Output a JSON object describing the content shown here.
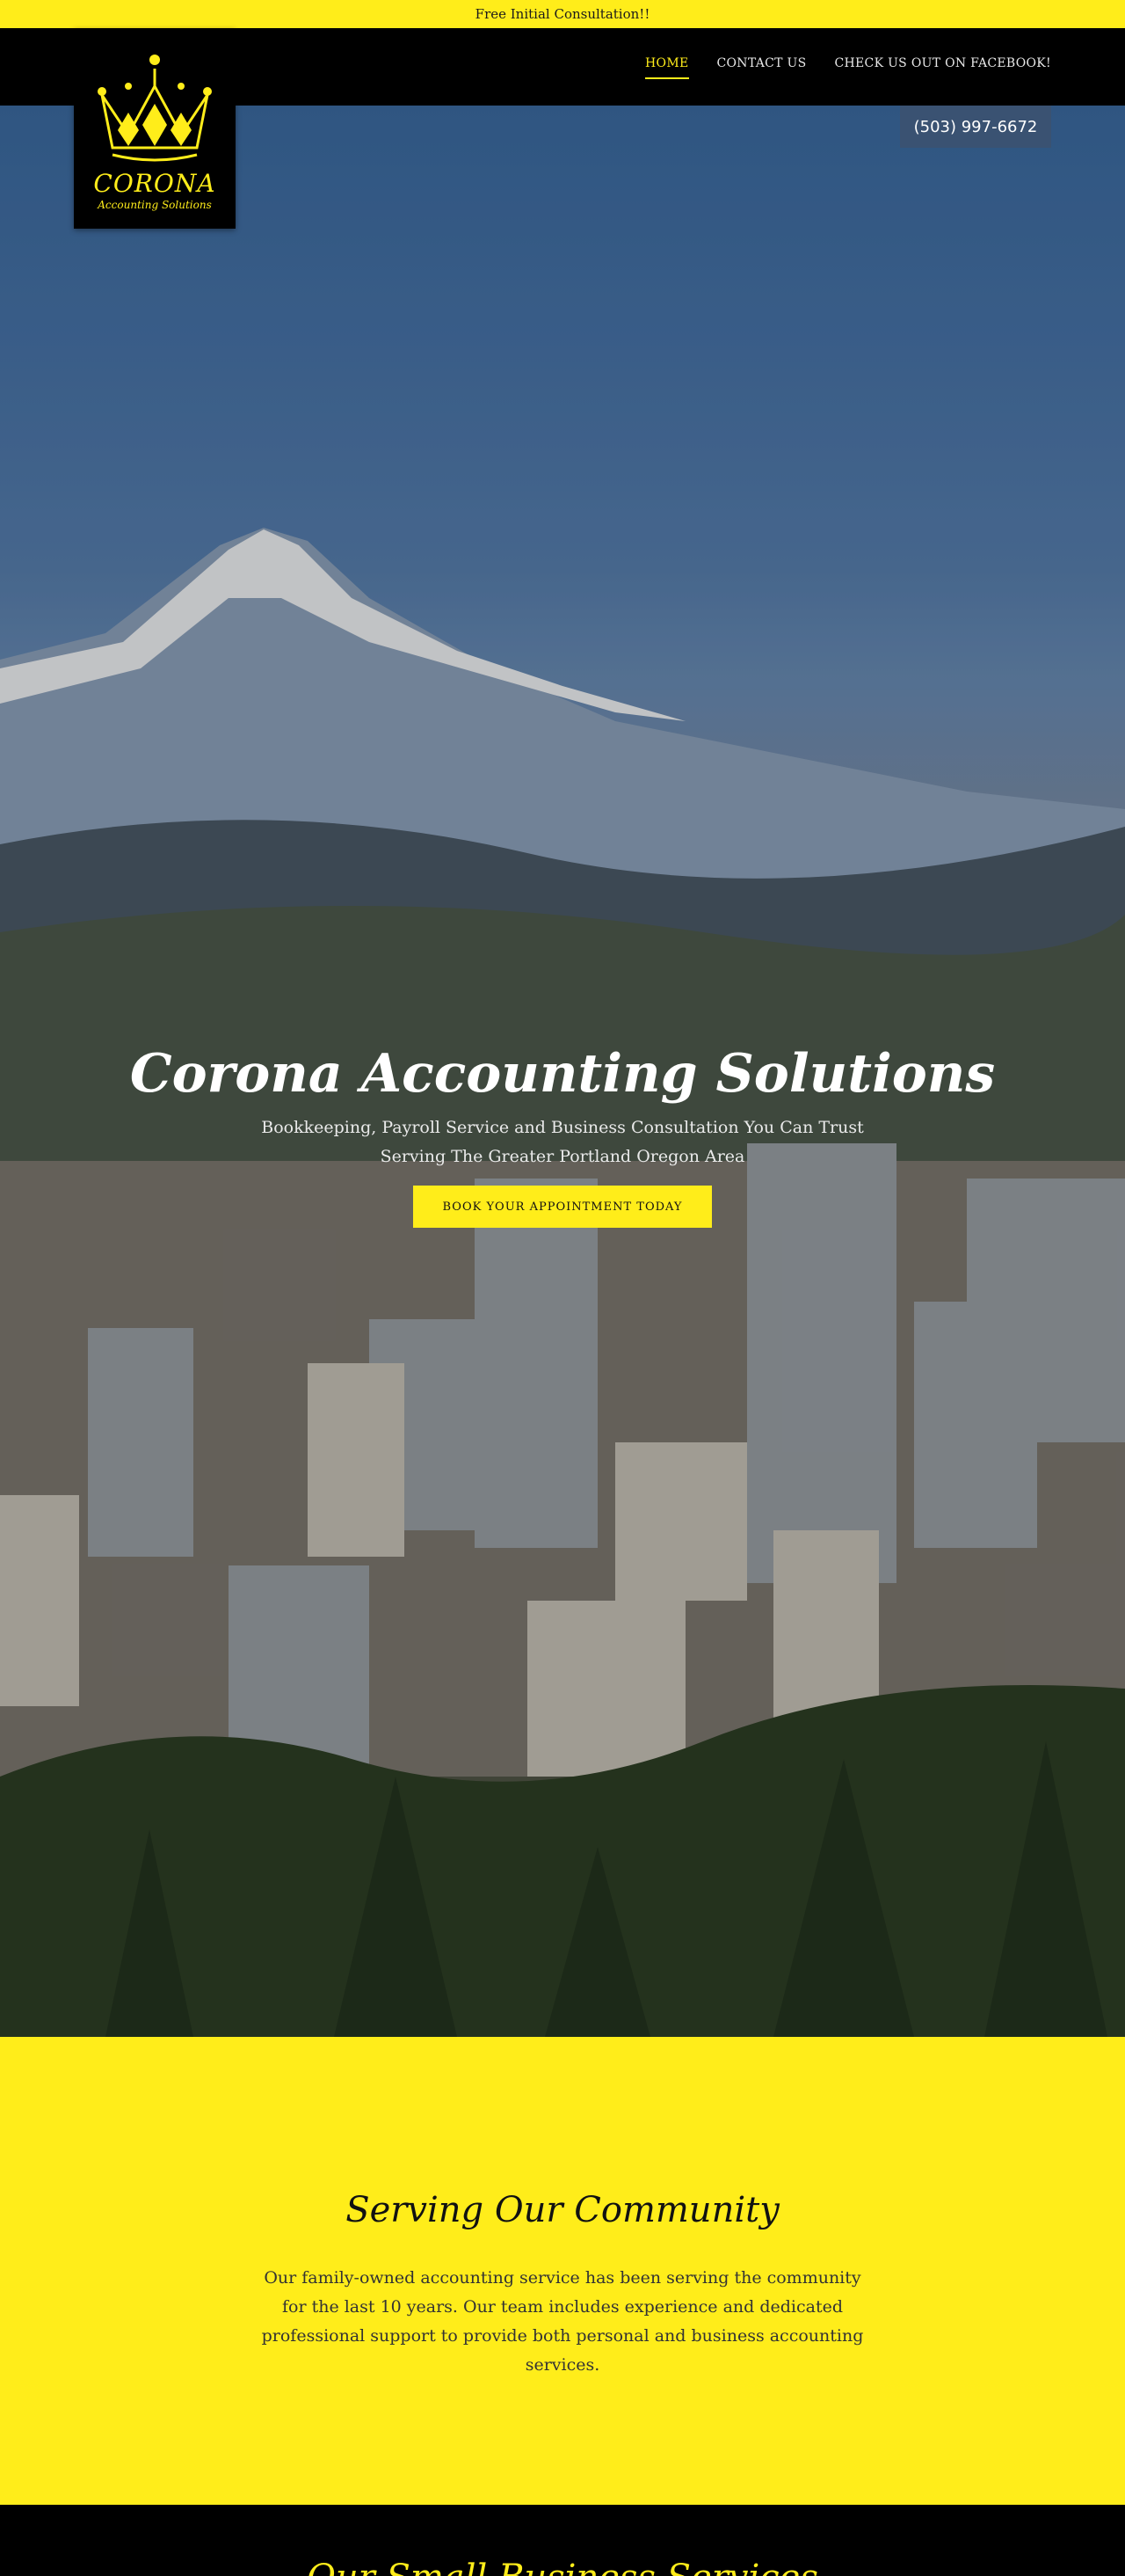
{
  "announcement": "Free Initial Consultation!!",
  "nav": {
    "links": [
      {
        "label": "HOME",
        "active": true
      },
      {
        "label": "CONTACT US",
        "active": false
      },
      {
        "label": "CHECK US OUT ON FACEBOOK!",
        "active": false
      }
    ]
  },
  "logo": {
    "name": "CORONA",
    "tagline": "Accounting  Solutions"
  },
  "phone": "(503) 997-6672",
  "hero": {
    "title": "Corona Accounting Solutions",
    "subtitle": "Bookkeeping, Payroll Service and Business Consultation You Can Trust Serving The Greater Portland Oregon Area",
    "cta": "BOOK YOUR APPOINTMENT TODAY"
  },
  "community": {
    "heading": "Serving Our Community",
    "body": "Our family-owned accounting service has been serving the community for the last 10 years. Our team includes experience and dedicated professional support to provide both personal and business accounting services."
  },
  "services": {
    "heading": "Our Small Business Services"
  },
  "colors": {
    "accent": "#ffed1a",
    "dark": "#000000",
    "phone_bg": "#3a5272"
  },
  "icons": [
    "crown-icon"
  ]
}
